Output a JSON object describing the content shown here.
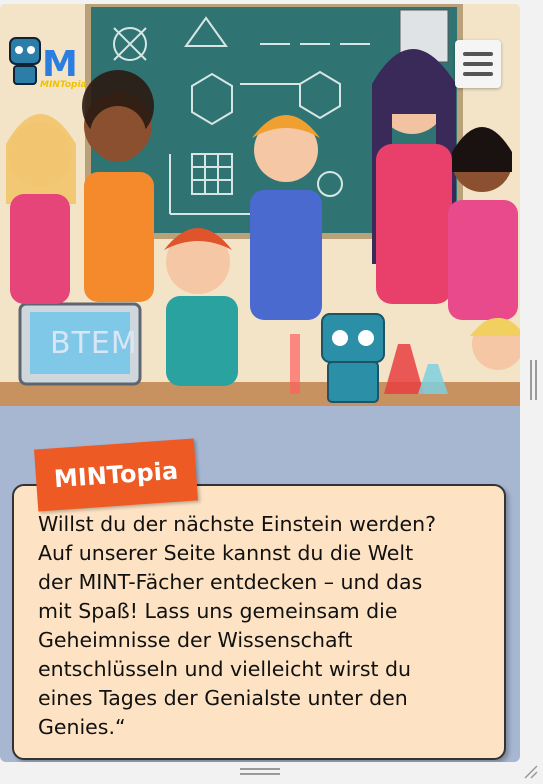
{
  "hero": {
    "logo_text": "MINTopia",
    "sign_text": "BTEM",
    "menu_icon": "hamburger-icon"
  },
  "badge": {
    "title": "MINTopia"
  },
  "intro": {
    "text": "Willst du der nächste Einstein werden?\nAuf unserer Seite kannst du die Welt\nder MINT-Fächer entdecken – und das\nmit Spaß! Lass uns gemeinsam die\nGeheimnisse der Wissenschaft\nentschlüsseln und vielleicht wirst du\neines Tages der Genialste unter den\nGenies.“"
  },
  "colors": {
    "page_bg": "#a7b7d2",
    "card_bg": "#fde3c4",
    "badge_bg": "#ee5a24",
    "chalkboard": "#2e6e6e"
  }
}
